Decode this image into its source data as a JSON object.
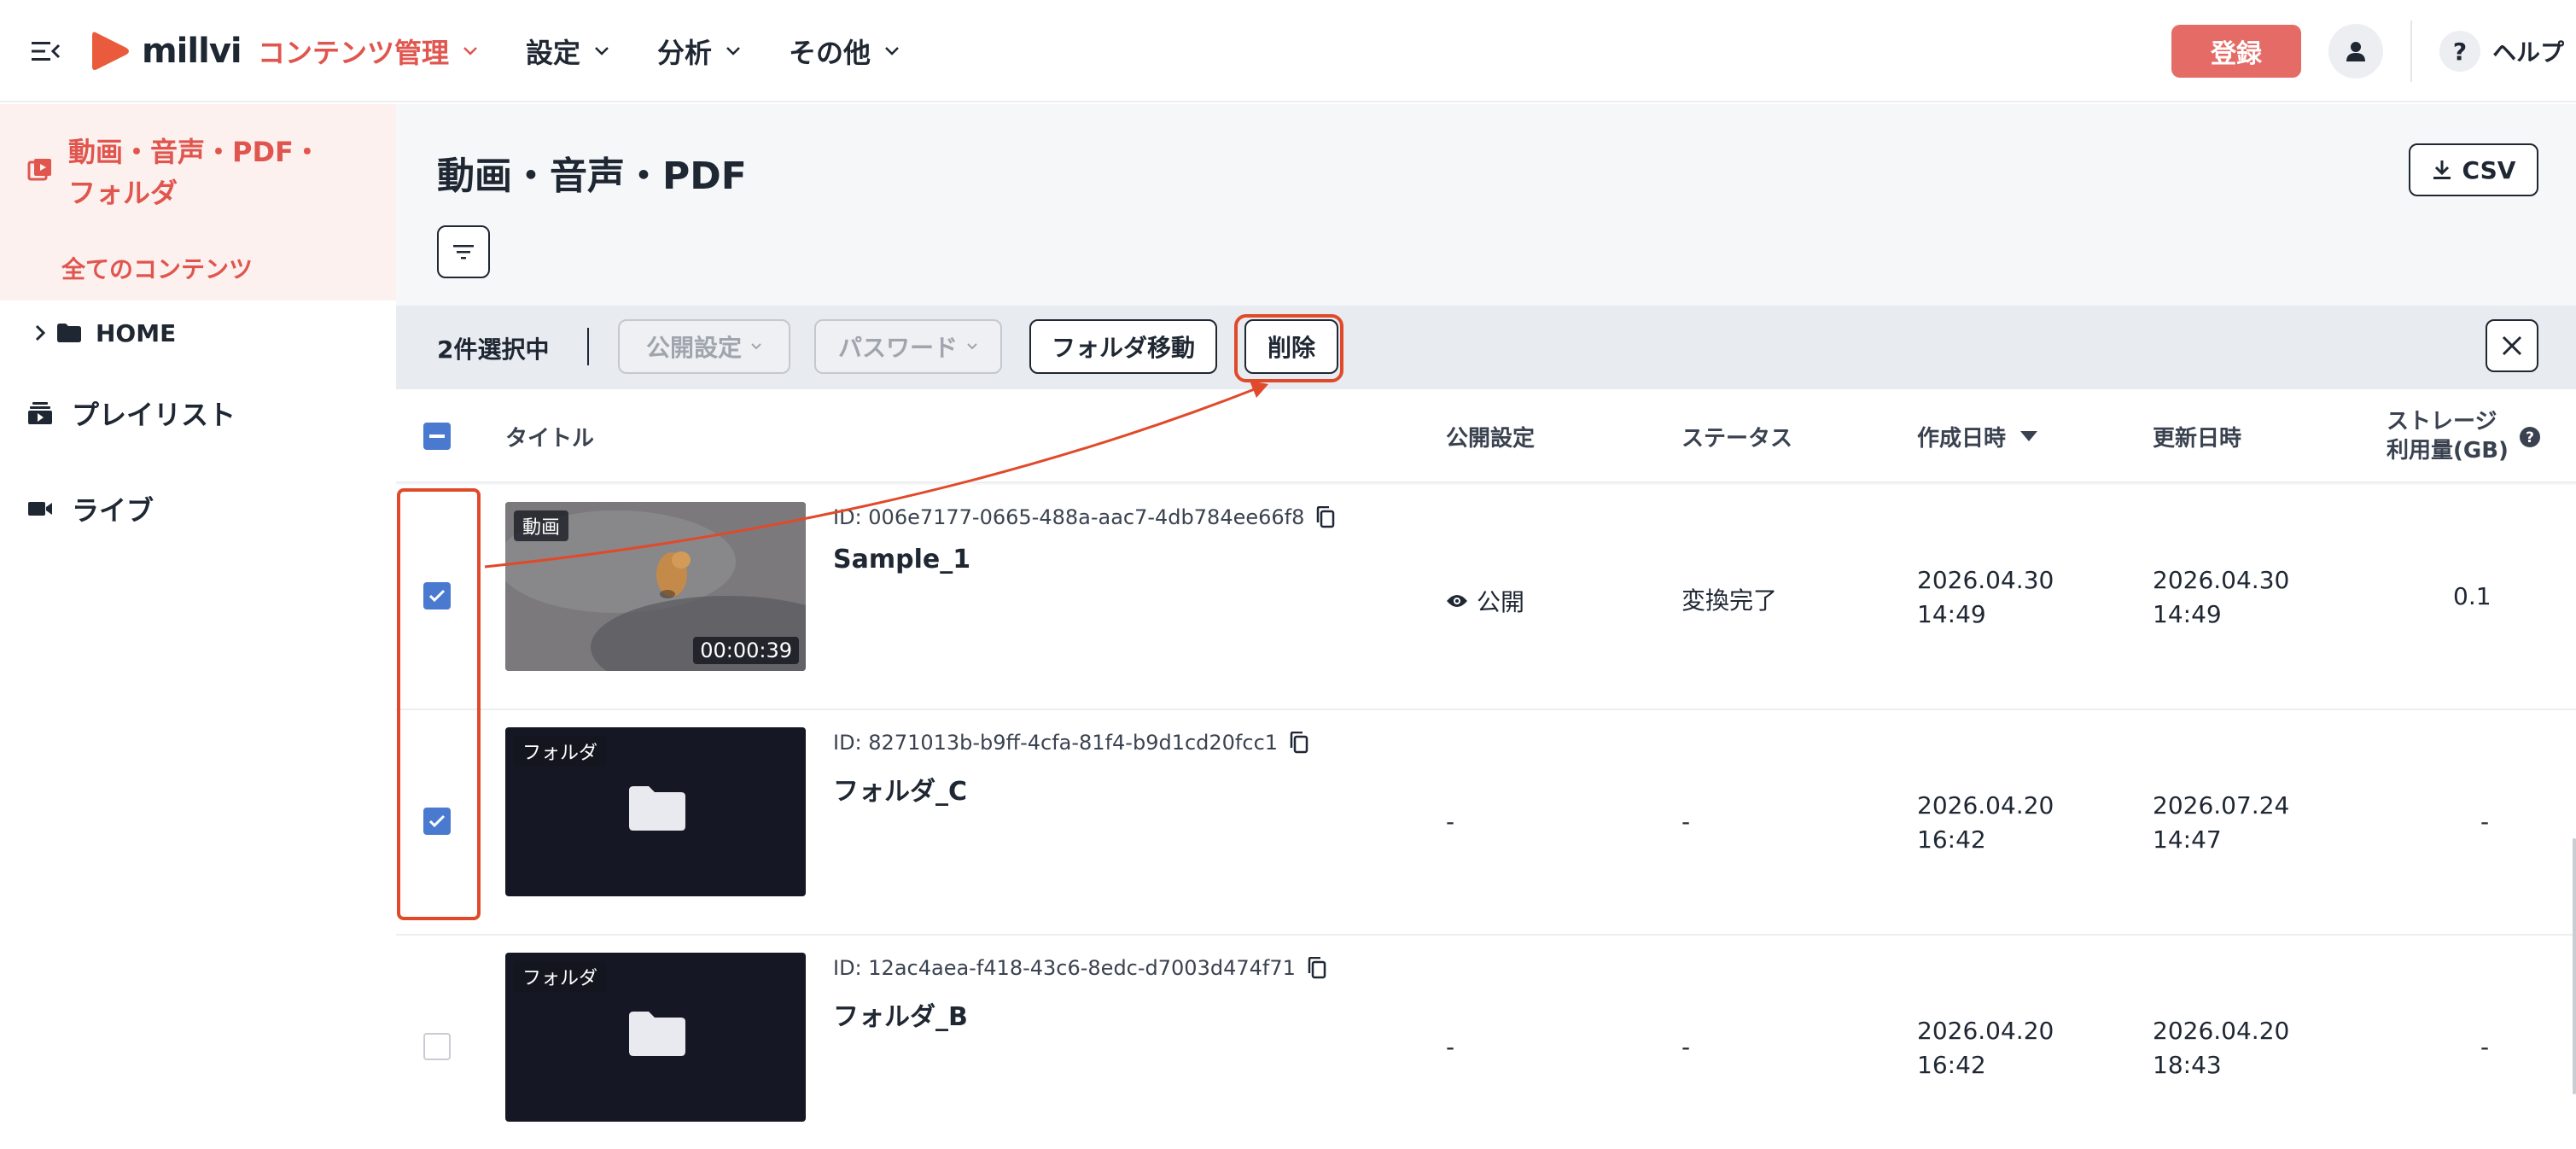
{
  "header": {
    "brand": "millvi",
    "nav": [
      {
        "label": "コンテンツ管理",
        "active": true
      },
      {
        "label": "設定",
        "active": false
      },
      {
        "label": "分析",
        "active": false
      },
      {
        "label": "その他",
        "active": false
      }
    ],
    "register_label": "登録",
    "help_label": "ヘルプ",
    "help_glyph": "?"
  },
  "sidebar": {
    "main_label": "動画・音声・PDF・フォルダ",
    "sub_label": "全てのコンテンツ",
    "home_label": "HOME",
    "items": [
      {
        "label": "プレイリスト",
        "icon": "playlist-icon"
      },
      {
        "label": "ライブ",
        "icon": "camera-icon"
      }
    ]
  },
  "main": {
    "title": "動画・音声・PDF",
    "csv_label": "CSV"
  },
  "actionbar": {
    "selected_count": "2件選択中",
    "publish_label": "公開設定",
    "password_label": "パスワード",
    "move_label": "フォルダ移動",
    "delete_label": "削除"
  },
  "table": {
    "headers": {
      "title": "タイトル",
      "publish": "公開設定",
      "status": "ステータス",
      "created": "作成日時",
      "updated": "更新日時",
      "storage_line1": "ストレージ",
      "storage_line2": "利用量(GB)"
    },
    "rows": [
      {
        "checked": true,
        "type": "動画",
        "duration": "00:00:39",
        "id": "ID: 006e7177-0665-488a-aac7-4db784ee66f8",
        "title": "Sample_1",
        "publish": "公開",
        "status": "変換完了",
        "created_date": "2026.04.30",
        "created_time": "14:49",
        "updated_date": "2026.04.30",
        "updated_time": "14:49",
        "storage": "0.1"
      },
      {
        "checked": true,
        "type": "フォルダ",
        "id": "ID: 8271013b-b9ff-4cfa-81f4-b9d1cd20fcc1",
        "title": "フォルダ_C",
        "publish": "-",
        "status": "-",
        "created_date": "2026.04.20",
        "created_time": "16:42",
        "updated_date": "2026.07.24",
        "updated_time": "14:47",
        "storage": "-"
      },
      {
        "checked": false,
        "type": "フォルダ",
        "id": "ID: 12ac4aea-f418-43c6-8edc-d7003d474f71",
        "title": "フォルダ_B",
        "publish": "-",
        "status": "-",
        "created_date": "2026.04.20",
        "created_time": "16:42",
        "updated_date": "2026.04.20",
        "updated_time": "18:43",
        "storage": "-"
      }
    ]
  },
  "colors": {
    "accent": "#e0564e",
    "register_bg": "#e56c66",
    "checkbox": "#4a7ad0",
    "annotation": "#e04a2a"
  }
}
